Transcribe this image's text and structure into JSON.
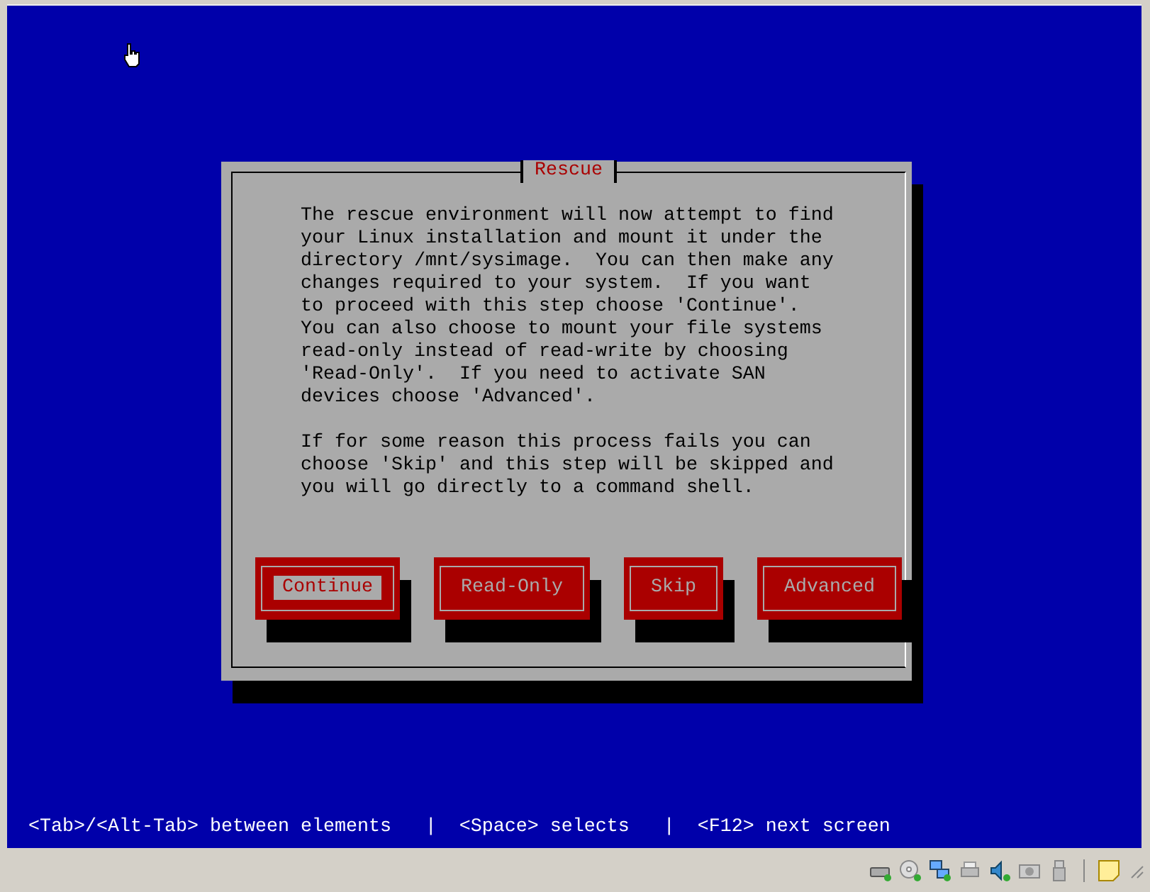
{
  "dialog": {
    "title": "Rescue",
    "paragraphs": [
      "The rescue environment will now attempt to find your Linux installation and mount it under the directory /mnt/sysimage.  You can then make any changes required to your system.  If you want to proceed with this step choose 'Continue'.  You can also choose to mount your file systems read-only instead of read-write by choosing 'Read-Only'.  If you need to activate SAN devices choose 'Advanced'.",
      "If for some reason this process fails you can choose 'Skip' and this step will be skipped and you will go directly to a command shell."
    ],
    "buttons": [
      {
        "label": "Continue",
        "selected": true
      },
      {
        "label": "Read-Only",
        "selected": false
      },
      {
        "label": "Skip",
        "selected": false
      },
      {
        "label": "Advanced",
        "selected": false
      }
    ]
  },
  "help_line": "<Tab>/<Alt-Tab> between elements   |  <Space> selects   |  <F12> next screen"
}
